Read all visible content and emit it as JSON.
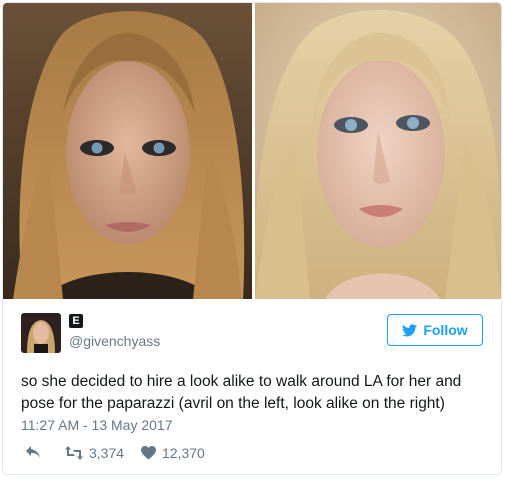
{
  "tweet": {
    "badge_letter": "E",
    "handle": "@givenchyass",
    "follow_label": "Follow",
    "text": "so she decided to hire a look alike to walk around LA for her and pose for the paparazzi (avril on the left, look alike on the right)",
    "timestamp": "11:27 AM - 13 May 2017",
    "retweets": "3,374",
    "likes": "12,370"
  },
  "icons": {
    "reply": "reply-icon",
    "retweet": "retweet-icon",
    "like": "heart-icon",
    "follow": "twitter-bird-icon"
  },
  "colors": {
    "accent": "#1da1f2",
    "secondary_text": "#657786",
    "text": "#14171a",
    "border": "#e1e8ed"
  }
}
